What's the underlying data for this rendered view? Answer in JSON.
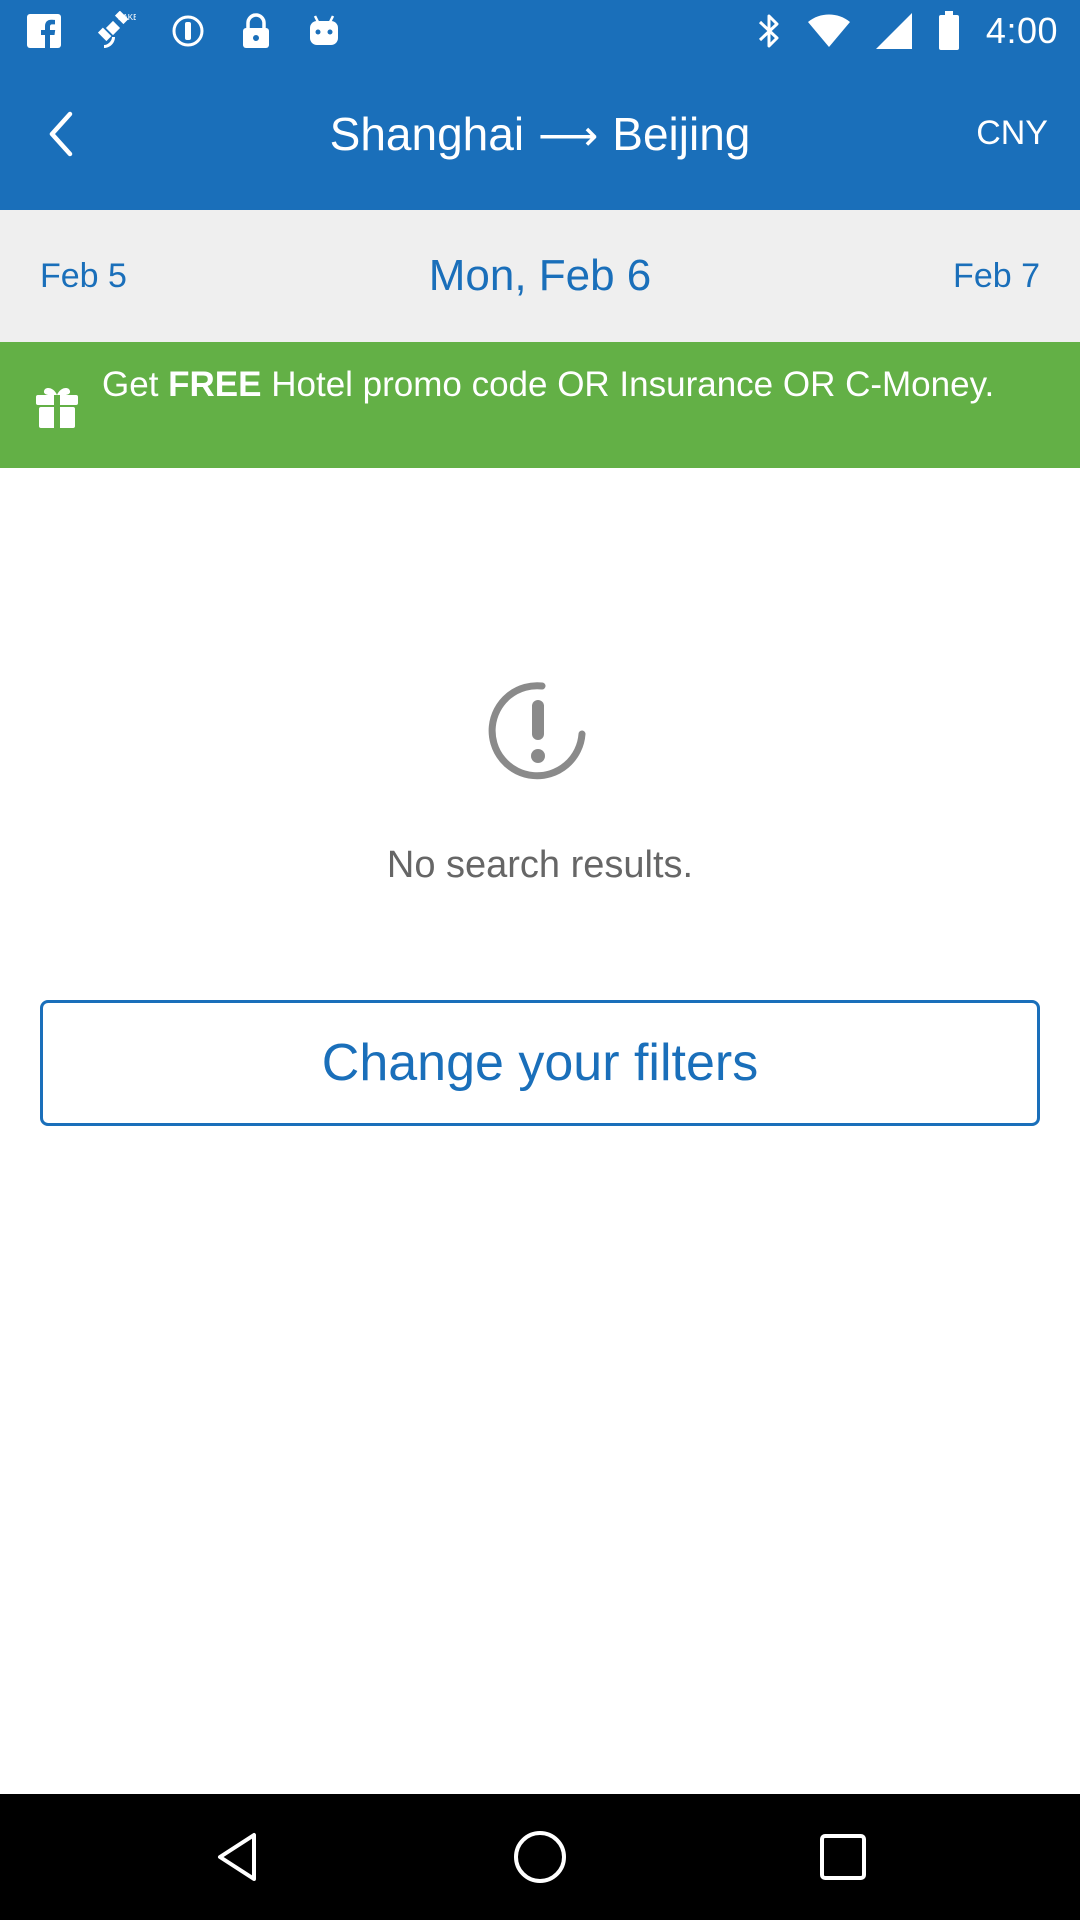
{
  "status_bar": {
    "time": "4:00",
    "left_icons": [
      "facebook-icon",
      "fake-gps-icon",
      "sync-icon",
      "lock-icon",
      "android-icon"
    ],
    "right_icons": [
      "bluetooth-icon",
      "wifi-icon",
      "signal-icon",
      "battery-icon"
    ]
  },
  "app_bar": {
    "origin": "Shanghai",
    "arrow": "⟶",
    "destination": "Beijing",
    "currency": "CNY",
    "background_color": "#1a6fba"
  },
  "date_bar": {
    "prev": "Feb 5",
    "current": "Mon, Feb 6",
    "next": "Feb 7"
  },
  "promo": {
    "text_before": "Get ",
    "text_bold": "FREE",
    "text_after": " Hotel promo code OR Insurance OR C-Money.",
    "background_color": "#63b046"
  },
  "empty_state": {
    "message": "No search results.",
    "button_label": "Change your filters"
  }
}
